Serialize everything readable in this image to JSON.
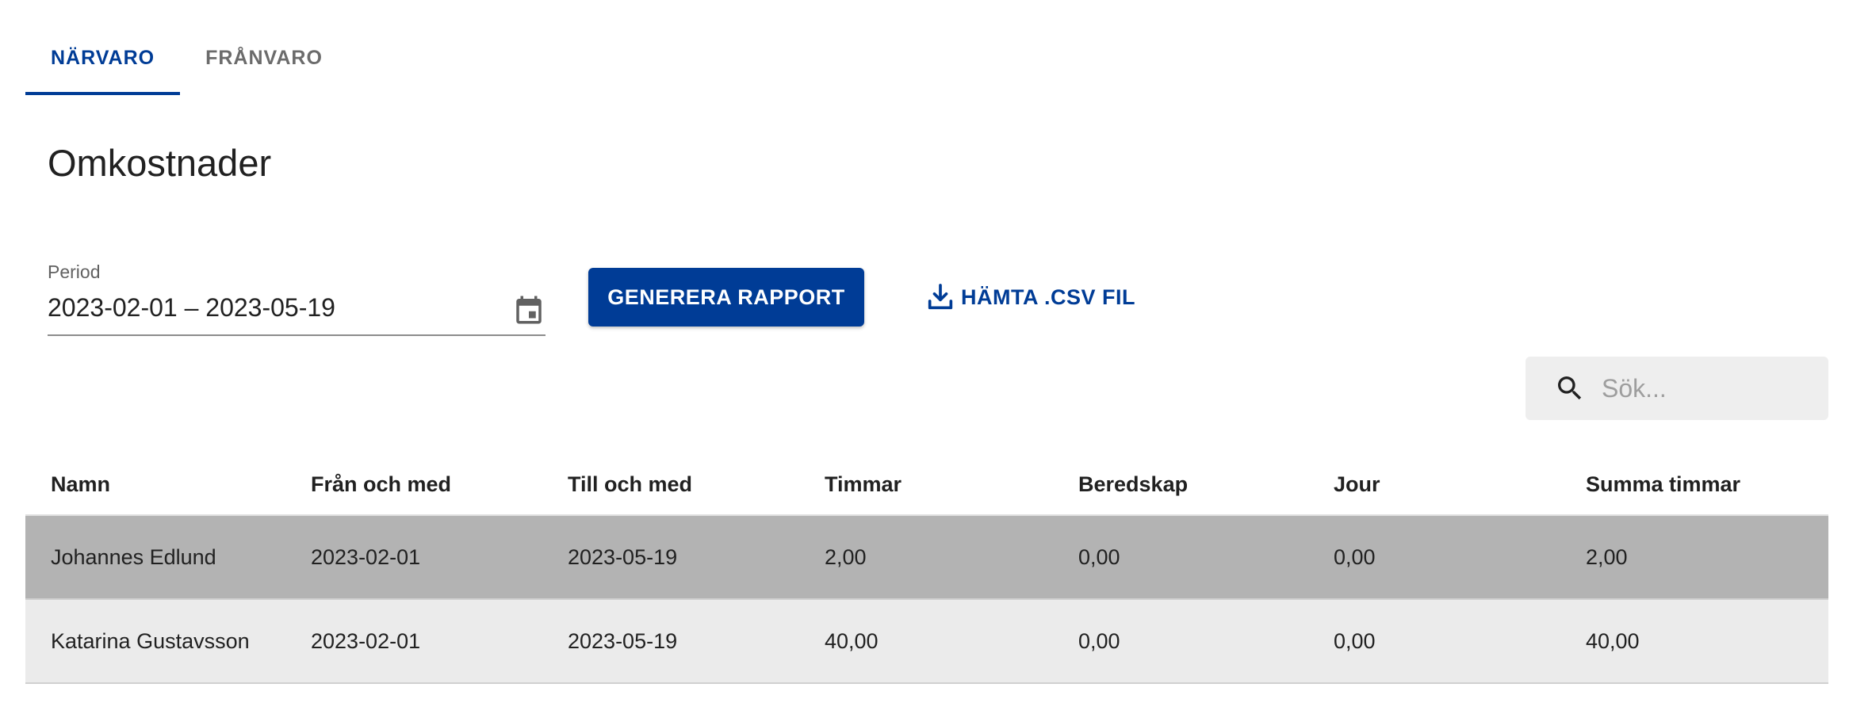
{
  "tabs": [
    {
      "label": "NÄRVARO",
      "active": true
    },
    {
      "label": "FRÅNVARO",
      "active": false
    }
  ],
  "page_title": "Omkostnader",
  "period": {
    "label": "Period",
    "value": "2023-02-01 – 2023-05-19",
    "icon": "calendar-icon"
  },
  "actions": {
    "generate_label": "GENERERA RAPPORT",
    "csv_label": "HÄMTA .CSV FIL",
    "csv_icon": "download-icon"
  },
  "search": {
    "placeholder": "Sök...",
    "value": "",
    "icon": "search-icon"
  },
  "table": {
    "columns": [
      "Namn",
      "Från och med",
      "Till och med",
      "Timmar",
      "Beredskap",
      "Jour",
      "Summa timmar"
    ],
    "rows": [
      {
        "selected": true,
        "cells": [
          "Johannes Edlund",
          "2023-02-01",
          "2023-05-19",
          "2,00",
          "0,00",
          "0,00",
          "2,00"
        ]
      },
      {
        "selected": false,
        "cells": [
          "Katarina Gustavsson",
          "2023-02-01",
          "2023-05-19",
          "40,00",
          "0,00",
          "0,00",
          "40,00"
        ]
      }
    ]
  },
  "colors": {
    "primary": "#003c96",
    "selected_row": "#b3b3b3",
    "row": "#ebebeb",
    "search_bg": "#eeeeee"
  }
}
